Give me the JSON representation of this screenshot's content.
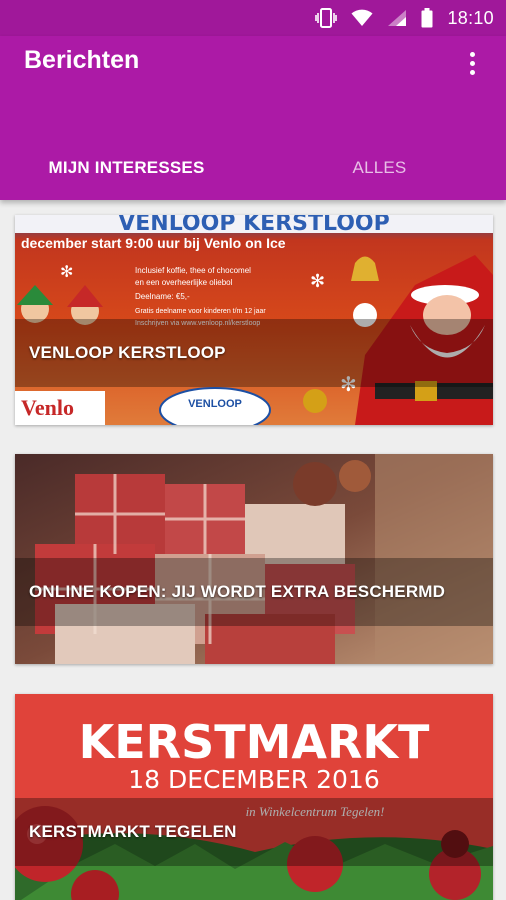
{
  "status_bar": {
    "time": "18:10",
    "icons": [
      "vibrate-icon",
      "wifi-icon",
      "signal-icon",
      "battery-icon"
    ]
  },
  "app_bar": {
    "title": "Berichten",
    "menu_icon": "more-vert-icon",
    "color": "#ac1aa6"
  },
  "tabs": [
    {
      "label": "MIJN INTERESSES",
      "selected": true
    },
    {
      "label": "ALLES",
      "selected": false
    }
  ],
  "posts": [
    {
      "title": "VENLOOP KERSTLOOP",
      "image_text": {
        "banner": "VENLOOP KERSTLOOP",
        "subtitle": "december start 9:00 uur bij Venlo on Ice",
        "line1": "Inclusief koffie, thee of chocomel",
        "line2": "en een overheerlijke oliebol",
        "line3": "Deelname: €5,-",
        "line4": "Gratis deelname voor kinderen t/m 12 jaar",
        "line5": "Inschrijven via www.venloop.nl/kerstloop",
        "logo": "VENLOOP",
        "logo2": "Venlo"
      }
    },
    {
      "title": "ONLINE KOPEN: JIJ WORDT EXTRA BESCHERMD"
    },
    {
      "title": "KERSTMARKT TEGELEN",
      "image_text": {
        "heading": "KERSTMARKT",
        "date": "18 DECEMBER 2016",
        "place": "in Winkelcentrum Tegelen!"
      }
    }
  ]
}
